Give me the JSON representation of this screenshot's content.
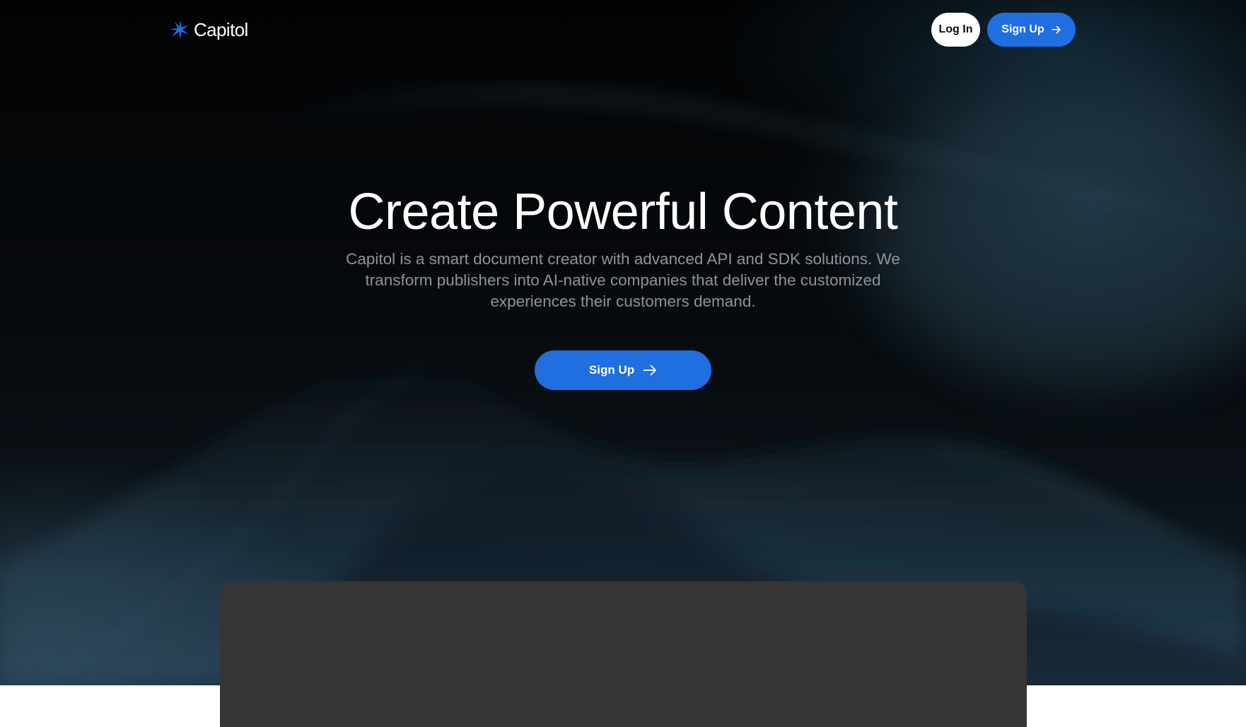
{
  "brand": {
    "name": "Capitol",
    "accent": "#1f6fe0",
    "icon": "sparkle-star-icon"
  },
  "nav": {
    "login_label": "Log In",
    "signup_label": "Sign Up",
    "signup_icon": "arrow-right-icon"
  },
  "hero": {
    "title": "Create Powerful Content",
    "subtitle": "Capitol is a smart document creator with advanced API and SDK solutions.  We transform publishers into AI-native companies that deliver the customized experiences their customers demand.",
    "cta_label": "Sign Up",
    "cta_icon": "arrow-right-icon"
  },
  "colors": {
    "background": "#020304",
    "button_blue": "#1f6fe0",
    "panel": "#353535",
    "subtitle_text": "#8e9399"
  }
}
